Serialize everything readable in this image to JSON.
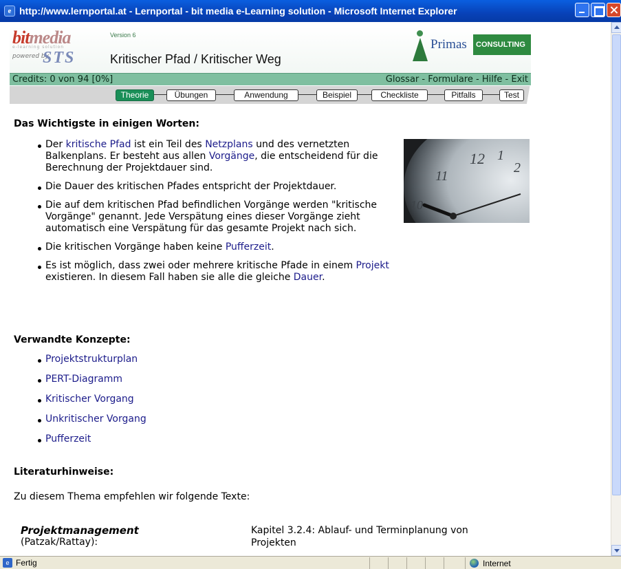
{
  "window": {
    "title": "http://www.lernportal.at - Lernportal - bit media e-Learning solution - Microsoft Internet Explorer"
  },
  "header": {
    "brand_bit": "bit",
    "brand_media": "media",
    "brand_sub": "e-learning solution",
    "powered_by": "powered by",
    "sts": "STS",
    "version": "Version 6",
    "title": "Kritischer Pfad / Kritischer Weg",
    "partner_name": "Primas",
    "partner_consulting": "CONSULTING"
  },
  "credits": {
    "text": "Credits: 0 von 94 [0%]",
    "links": [
      "Glossar",
      "Formulare",
      "Hilfe",
      "Exit"
    ],
    "separator": " - "
  },
  "tabs": [
    {
      "label": "Theorie",
      "active": true
    },
    {
      "label": "Übungen",
      "active": false
    },
    {
      "label": "Anwendung",
      "active": false
    },
    {
      "label": "Beispiel",
      "active": false
    },
    {
      "label": "Checkliste",
      "active": false
    },
    {
      "label": "Pitfalls",
      "active": false
    },
    {
      "label": "Test",
      "active": false
    }
  ],
  "section_main": {
    "heading": "Das Wichtigste in einigen Worten:",
    "b1_t1": "Der ",
    "b1_l1": "kritische Pfad",
    "b1_t2": " ist ein Teil des ",
    "b1_l2": "Netzplans",
    "b1_t3": " und des vernetzten Balkenplans. Er besteht aus allen ",
    "b1_l3": "Vorgänge",
    "b1_t4": ", die entscheidend für die Berechnung der Projektdauer sind.",
    "b2": "Die Dauer des kritischen Pfades entspricht der Projektdauer.",
    "b3": "Die auf dem kritischen Pfad befindlichen Vorgänge werden \"kritische Vorgänge\" genannt. Jede Verspätung eines dieser Vorgänge zieht automatisch eine Verspätung für das gesamte Projekt nach sich.",
    "b4_t1": "Die kritischen Vorgänge haben keine ",
    "b4_l1": "Pufferzeit",
    "b4_t2": ".",
    "b5_t1": "Es ist möglich, dass zwei oder mehrere kritische Pfade in einem ",
    "b5_l1": "Projekt",
    "b5_t2": " existieren. In diesem Fall haben sie alle die gleiche ",
    "b5_l2": "Dauer",
    "b5_t3": "."
  },
  "related": {
    "heading": "Verwandte Konzepte:",
    "items": [
      "Projektstrukturplan",
      "PERT-Diagramm",
      "Kritischer Vorgang",
      "Unkritischer Vorgang",
      "Pufferzeit"
    ]
  },
  "literature": {
    "heading": "Literaturhinweise:",
    "intro": "Zu diesem Thema empfehlen wir folgende Texte:",
    "book_title": "Projektmanagement",
    "book_authors": "(Patzak/Rattay):",
    "book_chapter": "Kapitel 3.2.4: Ablauf- und Terminplanung von Projekten"
  },
  "statusbar": {
    "status": "Fertig",
    "zone": "Internet"
  },
  "colors": {
    "titlebar": "#0842b8",
    "credits_bar": "#7fbfa0",
    "active_tab": "#1a8f58",
    "link": "#1b1b8a"
  }
}
